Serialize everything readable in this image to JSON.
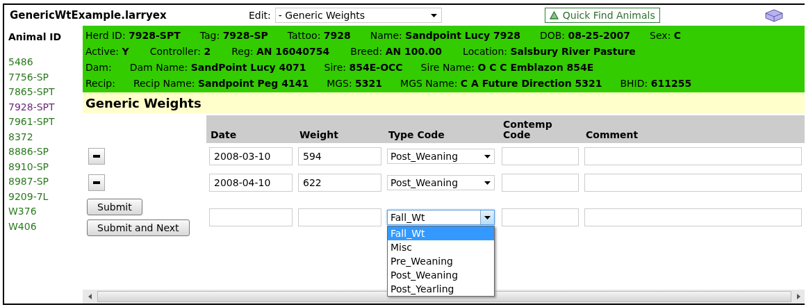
{
  "header": {
    "title": "GenericWtExample.larryex",
    "edit_label": "Edit:",
    "edit_value": "- Generic Weights",
    "quick_find": "Quick Find Animals"
  },
  "sidebar": {
    "heading": "Animal ID",
    "items": [
      {
        "label": "5486",
        "selected": false
      },
      {
        "label": "7756-SP",
        "selected": false
      },
      {
        "label": "7865-SPT",
        "selected": false
      },
      {
        "label": "7928-SPT",
        "selected": true
      },
      {
        "label": "7961-SPT",
        "selected": false
      },
      {
        "label": "8372",
        "selected": false
      },
      {
        "label": "8886-SP",
        "selected": false
      },
      {
        "label": "8910-SP",
        "selected": false
      },
      {
        "label": "8987-SP",
        "selected": false
      },
      {
        "label": "9209-7L",
        "selected": false
      },
      {
        "label": "W376",
        "selected": false
      },
      {
        "label": "W406",
        "selected": false
      }
    ]
  },
  "info_lines": [
    [
      {
        "label": "Herd ID:",
        "value": "7928-SPT"
      },
      {
        "label": "Tag:",
        "value": "7928-SP"
      },
      {
        "label": "Tattoo:",
        "value": "7928"
      },
      {
        "label": "Name:",
        "value": "Sandpoint Lucy 7928"
      },
      {
        "label": "DOB:",
        "value": "08-25-2007"
      },
      {
        "label": "Sex:",
        "value": "C"
      }
    ],
    [
      {
        "label": "Active:",
        "value": "Y"
      },
      {
        "label": "Controller:",
        "value": "2"
      },
      {
        "label": "Reg:",
        "value": "AN 16040754"
      },
      {
        "label": "Breed:",
        "value": "AN 100.00"
      },
      {
        "label": "Location:",
        "value": "Salsbury River Pasture"
      }
    ],
    [
      {
        "label": "Dam:"
      },
      {
        "label": "Dam Name:",
        "value": "SandPoint Lucy 4071"
      },
      {
        "label": "Sire:",
        "value": "854E-OCC"
      },
      {
        "label": "Sire Name:",
        "value": "O C C Emblazon 854E"
      }
    ],
    [
      {
        "label": "Recip:"
      },
      {
        "label": "Recip Name:",
        "value": "Sandpoint Peg 4141"
      },
      {
        "label": "MGS:",
        "value": "5321"
      },
      {
        "label": "MGS Name:",
        "value": "C A Future Direction 5321"
      },
      {
        "label": "BHID:",
        "value": "611255"
      }
    ]
  ],
  "section_title": "Generic Weights",
  "table": {
    "columns": [
      "Date",
      "Weight",
      "Type Code",
      "Contemp Code",
      "Comment"
    ],
    "rows": [
      {
        "date": "2008-03-10",
        "weight": "594",
        "type_code": "Post_Weaning"
      },
      {
        "date": "2008-04-10",
        "weight": "622",
        "type_code": "Post_Weaning"
      }
    ],
    "new_row": {
      "type_code": "Fall_Wt",
      "expanded": true,
      "options": [
        {
          "label": "Fall_Wt",
          "selected": true
        },
        {
          "label": "Misc",
          "selected": false
        },
        {
          "label": "Pre_Weaning",
          "selected": false
        },
        {
          "label": "Post_Weaning",
          "selected": false
        },
        {
          "label": "Post_Yearling",
          "selected": false
        }
      ]
    }
  },
  "buttons": [
    "Submit",
    "Submit and Next"
  ]
}
